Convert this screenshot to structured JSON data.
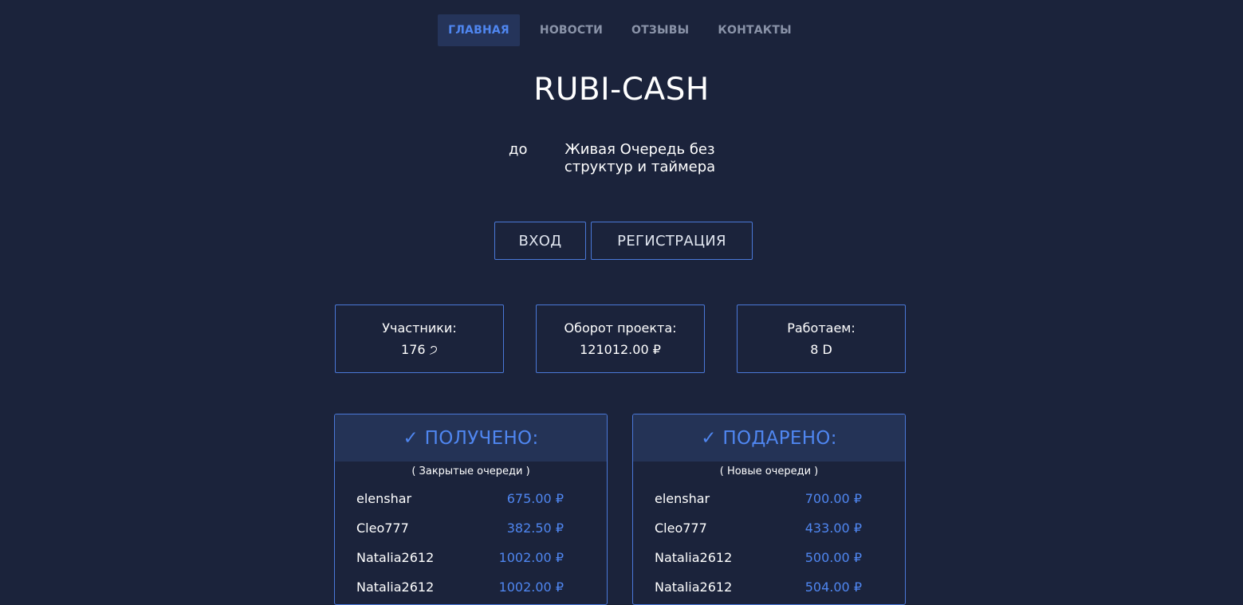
{
  "nav": {
    "items": [
      {
        "label": "ГЛАВНАЯ",
        "active": true
      },
      {
        "label": "НОВОСТИ",
        "active": false
      },
      {
        "label": "ОТЗЫВЫ",
        "active": false
      },
      {
        "label": "КОНТАКТЫ",
        "active": false
      }
    ]
  },
  "hero": {
    "title": "RUBI-CASH",
    "prefix": "до",
    "tagline": "Живая Очередь без структур и таймера"
  },
  "buttons": {
    "login": "ВХОД",
    "register": "РЕГИСТРАЦИЯ"
  },
  "stats": [
    {
      "label": "Участники:",
      "value": "176 ੭"
    },
    {
      "label": "Оборот проекта:",
      "value": "121012.00 ₽"
    },
    {
      "label": "Работаем:",
      "value": "8 D"
    }
  ],
  "panels": {
    "received": {
      "title": "✓ ПОЛУЧЕНО:",
      "subtitle": "( Закрытые очереди )",
      "rows": [
        {
          "name": "elenshar",
          "amount": "675.00 ₽"
        },
        {
          "name": "Cleo777",
          "amount": "382.50 ₽"
        },
        {
          "name": "Natalia2612",
          "amount": "1002.00 ₽"
        },
        {
          "name": "Natalia2612",
          "amount": "1002.00 ₽"
        }
      ]
    },
    "donated": {
      "title": "✓ ПОДАРЕНО:",
      "subtitle": "( Новые очереди )",
      "rows": [
        {
          "name": "elenshar",
          "amount": "700.00 ₽"
        },
        {
          "name": "Cleo777",
          "amount": "433.00 ₽"
        },
        {
          "name": "Natalia2612",
          "amount": "500.00 ₽"
        },
        {
          "name": "Natalia2612",
          "amount": "504.00 ₽"
        }
      ]
    }
  },
  "colors": {
    "background": "#1b233b",
    "accent": "#4f86f0",
    "border": "#4a78d8",
    "panel_header": "#243356"
  }
}
